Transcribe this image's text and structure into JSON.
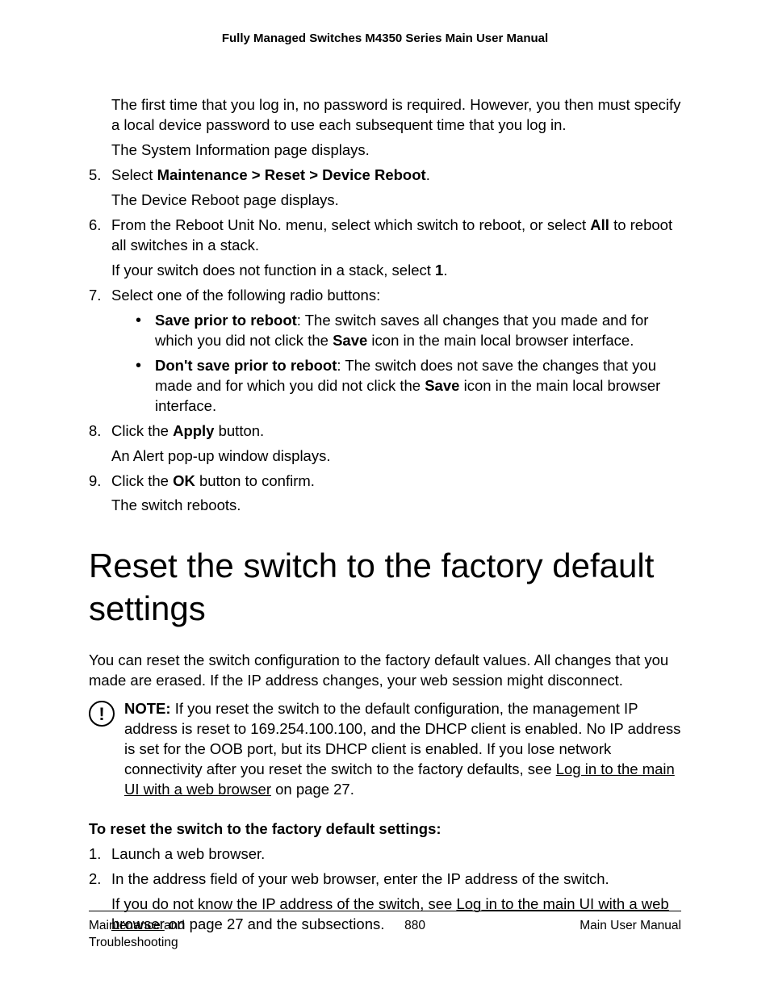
{
  "header": {
    "title": "Fully Managed Switches M4350 Series Main User Manual"
  },
  "intro": {
    "p1": "The first time that you log in, no password is required. However, you then must specify a local device password to use each subsequent time that you log in.",
    "p2": "The System Information page displays."
  },
  "step5": {
    "num": "5.",
    "pre": "Select ",
    "bold": "Maintenance > Reset > Device Reboot",
    "post": ".",
    "sub": "The Device Reboot page displays."
  },
  "step6": {
    "num": "6.",
    "part1": "From the Reboot Unit No. menu, select which switch to reboot, or select ",
    "bold1": "All",
    "part2": " to reboot all switches in a stack.",
    "sub1": "If your switch does not function in a stack, select ",
    "bold2": "1",
    "sub2": "."
  },
  "step7": {
    "num": "7.",
    "text": "Select one of the following radio buttons:",
    "b1": {
      "bold": "Save prior to reboot",
      "t1": ": The switch saves all changes that you made and for which you did not click the ",
      "bold2": "Save",
      "t2": " icon in the main local browser interface."
    },
    "b2": {
      "bold": "Don't save prior to reboot",
      "t1": ": The switch does not save the changes that you made and for which you did not click the ",
      "bold2": "Save",
      "t2": " icon in the main local browser interface."
    }
  },
  "step8": {
    "num": "8.",
    "t1": "Click the ",
    "bold": "Apply",
    "t2": " button.",
    "sub": "An Alert pop-up window displays."
  },
  "step9": {
    "num": "9.",
    "t1": "Click the ",
    "bold": "OK",
    "t2": " button to confirm.",
    "sub": "The switch reboots."
  },
  "section": {
    "title": "Reset the switch to the factory default settings",
    "intro": "You can reset the switch configuration to the factory default values. All changes that you made are erased. If the IP address changes, your web session might disconnect."
  },
  "note": {
    "label": "NOTE:",
    "t1": "  If you reset the switch to the default configuration, the management IP address is reset to 169.254.100.100, and the DHCP client is enabled. No IP address is set for the OOB port, but its DHCP client is enabled. If you lose network connectivity after you reset the switch to the factory defaults, see ",
    "link": "Log in to the main UI with a web browser",
    "t2": " on page 27."
  },
  "subhead": "To reset the switch to the factory default settings:",
  "rstep1": {
    "num": "1.",
    "text": "Launch a web browser."
  },
  "rstep2": {
    "num": "2.",
    "text": "In the address field of your web browser, enter the IP address of the switch.",
    "sub1": "If you do not know the IP address of the switch, see ",
    "link": "Log in to the main UI with a web browser",
    "sub2": " on page 27 and the subsections."
  },
  "footer": {
    "left": "Maintenance and Troubleshooting",
    "center": "880",
    "right": "Main User Manual"
  }
}
